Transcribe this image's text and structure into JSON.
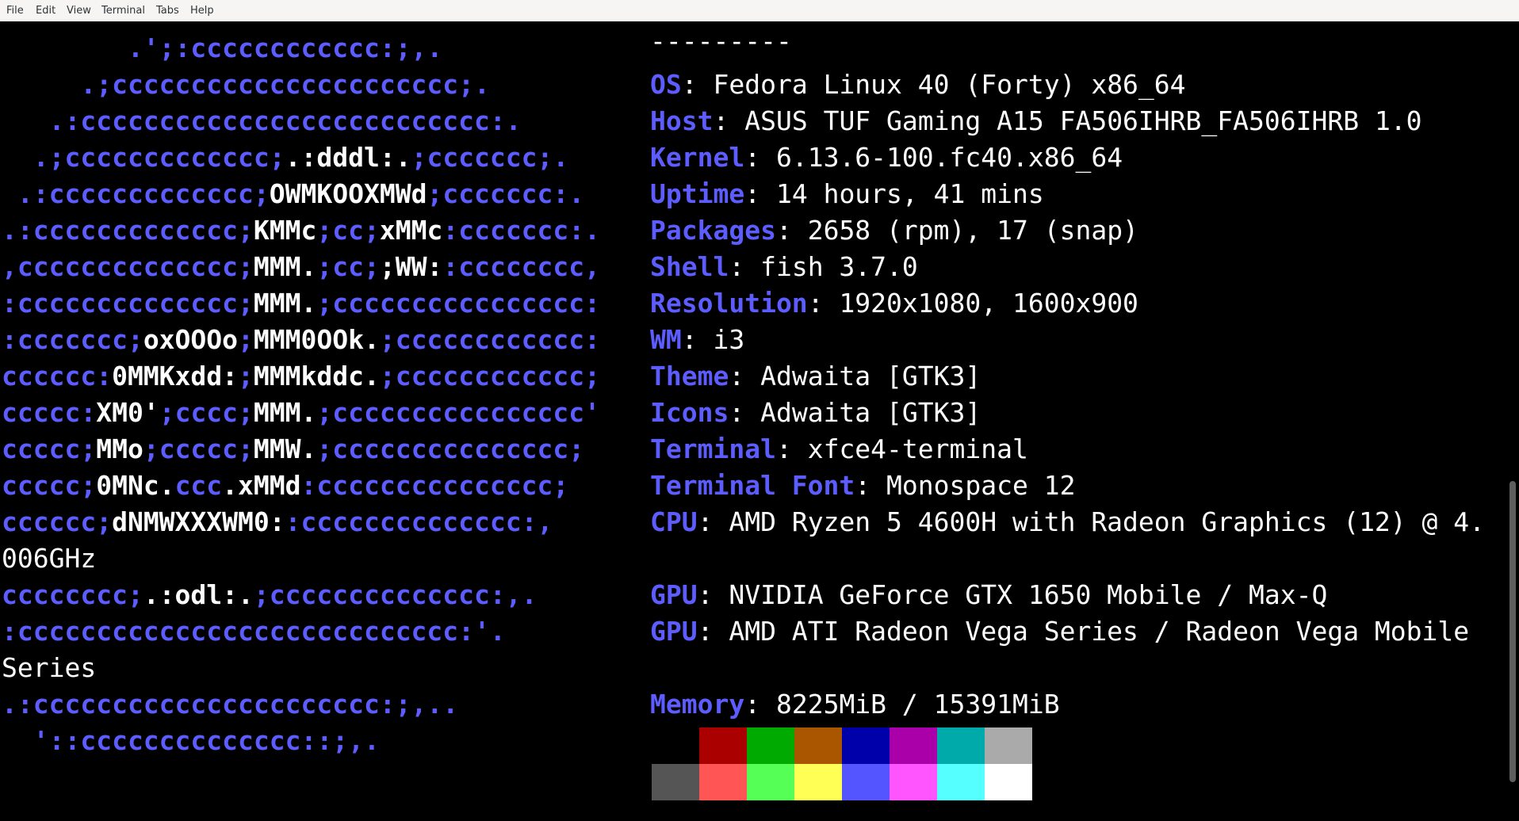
{
  "menubar": {
    "items": [
      "File",
      "Edit",
      "View",
      "Terminal",
      "Tabs",
      "Help"
    ]
  },
  "logo_lines": [
    [
      [
        "b",
        "        .';:cccccccccccc:;,."
      ]
    ],
    [
      [
        "b",
        "     .;cccccccccccccccccccccc;."
      ]
    ],
    [
      [
        "b",
        "   .:cccccccccccccccccccccccccc:."
      ]
    ],
    [
      [
        "b",
        "  .;ccccccccccccc;"
      ],
      [
        "w",
        ".:dddl:."
      ],
      [
        "b",
        ";ccccccc;."
      ]
    ],
    [
      [
        "b",
        " .:ccccccccccccc;"
      ],
      [
        "w",
        "OWMKOOXMWd"
      ],
      [
        "b",
        ";ccccccc:."
      ]
    ],
    [
      [
        "b",
        ".:ccccccccccccc;"
      ],
      [
        "w",
        "KMMc"
      ],
      [
        "b",
        ";cc;"
      ],
      [
        "w",
        "xMMc"
      ],
      [
        "b",
        ":ccccccc:."
      ]
    ],
    [
      [
        "b",
        ",cccccccccccccc;"
      ],
      [
        "w",
        "MMM."
      ],
      [
        "b",
        ";cc;"
      ],
      [
        "w",
        ";WW:"
      ],
      [
        "b",
        ":cccccccc,"
      ]
    ],
    [
      [
        "b",
        ":cccccccccccccc;"
      ],
      [
        "w",
        "MMM."
      ],
      [
        "b",
        ";cccccccccccccccc:"
      ]
    ],
    [
      [
        "b",
        ":ccccccc;"
      ],
      [
        "w",
        "oxOOOo"
      ],
      [
        "b",
        ";"
      ],
      [
        "w",
        "MMM0OOk."
      ],
      [
        "b",
        ";cccccccccccc:"
      ]
    ],
    [
      [
        "b",
        "cccccc:"
      ],
      [
        "w",
        "0MMKxdd:"
      ],
      [
        "b",
        ";"
      ],
      [
        "w",
        "MMMkddc."
      ],
      [
        "b",
        ";cccccccccccc;"
      ]
    ],
    [
      [
        "b",
        "ccccc:"
      ],
      [
        "w",
        "XM0'"
      ],
      [
        "b",
        ";cccc;"
      ],
      [
        "w",
        "MMM."
      ],
      [
        "b",
        ";cccccccccccccccc'"
      ]
    ],
    [
      [
        "b",
        "ccccc;"
      ],
      [
        "w",
        "MMo"
      ],
      [
        "b",
        ";ccccc;"
      ],
      [
        "w",
        "MMW."
      ],
      [
        "b",
        ";ccccccccccccccc;"
      ]
    ],
    [
      [
        "b",
        "ccccc;"
      ],
      [
        "w",
        "0MNc."
      ],
      [
        "b",
        "ccc"
      ],
      [
        "w",
        ".xMMd"
      ],
      [
        "b",
        ":ccccccccccccccc;"
      ]
    ],
    [
      [
        "b",
        "cccccc;"
      ],
      [
        "w",
        "dNMWXXXWM0:"
      ],
      [
        "b",
        ":cccccccccccccc:,"
      ]
    ],
    [
      [
        "t",
        "006GHz"
      ]
    ],
    [
      [
        "b",
        "cccccccc;"
      ],
      [
        "w",
        ".:odl:."
      ],
      [
        "b",
        ";cccccccccccccc:,."
      ]
    ],
    [
      [
        "b",
        ":cccccccccccccccccccccccccccc:'."
      ]
    ],
    [
      [
        "t",
        "Series"
      ]
    ],
    [
      [
        "b",
        ".:cccccccccccccccccccccc:;,.."
      ]
    ],
    [
      [
        "b",
        "  '::cccccccccccccc::;,."
      ]
    ]
  ],
  "separator": "---------",
  "info": [
    {
      "key": "OS",
      "value": "Fedora Linux 40 (Forty) x86_64"
    },
    {
      "key": "Host",
      "value": "ASUS TUF Gaming A15 FA506IHRB_FA506IHRB 1.0"
    },
    {
      "key": "Kernel",
      "value": "6.13.6-100.fc40.x86_64"
    },
    {
      "key": "Uptime",
      "value": "14 hours, 41 mins"
    },
    {
      "key": "Packages",
      "value": "2658 (rpm), 17 (snap)"
    },
    {
      "key": "Shell",
      "value": "fish 3.7.0"
    },
    {
      "key": "Resolution",
      "value": "1920x1080, 1600x900"
    },
    {
      "key": "WM",
      "value": "i3"
    },
    {
      "key": "Theme",
      "value": "Adwaita [GTK3]"
    },
    {
      "key": "Icons",
      "value": "Adwaita [GTK3]"
    },
    {
      "key": "Terminal",
      "value": "xfce4-terminal"
    },
    {
      "key": "Terminal Font",
      "value": "Monospace 12"
    },
    {
      "key": "CPU",
      "value": "AMD Ryzen 5 4600H with Radeon Graphics (12) @ 4."
    },
    {
      "key": "",
      "value": ""
    },
    {
      "key": "GPU",
      "value": "NVIDIA GeForce GTX 1650 Mobile / Max-Q"
    },
    {
      "key": "GPU",
      "value": "AMD ATI Radeon Vega Series / Radeon Vega Mobile"
    },
    {
      "key": "",
      "value": ""
    },
    {
      "key": "Memory",
      "value": "8225MiB / 15391MiB"
    }
  ],
  "palette": {
    "normal": [
      "#000000",
      "#aa0000",
      "#00aa00",
      "#aa5500",
      "#0000aa",
      "#aa00aa",
      "#00aaaa",
      "#aaaaaa"
    ],
    "bright": [
      "#555555",
      "#ff5555",
      "#55ff55",
      "#ffff55",
      "#5555ff",
      "#ff55ff",
      "#55ffff",
      "#ffffff"
    ]
  },
  "colors": {
    "accent_blue": "#5d5dff",
    "text": "#ffffff",
    "background": "#000000"
  }
}
